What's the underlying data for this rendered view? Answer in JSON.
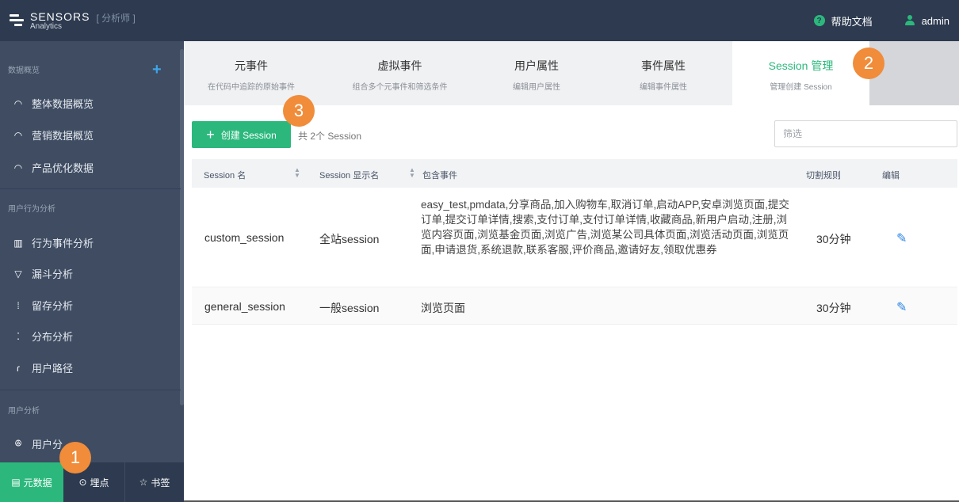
{
  "topbar": {
    "logo_name": "SENSORS",
    "logo_sub": "Analytics",
    "role": "[ 分析师 ]",
    "help": "帮助文档",
    "user": "admin"
  },
  "sidebar": {
    "sections": [
      {
        "title": "数据概览",
        "items": [
          "整体数据概览",
          "营销数据概览",
          "产品优化数据"
        ]
      },
      {
        "title": "用户行为分析",
        "items": [
          "行为事件分析",
          "漏斗分析",
          "留存分析",
          "分布分析",
          "用户路径"
        ]
      },
      {
        "title": "用户分析",
        "items": [
          "用户分"
        ]
      }
    ],
    "bottom": {
      "meta": "元数据",
      "track": "埋点",
      "bookmark": "书签"
    }
  },
  "tabs": [
    {
      "title": "元事件",
      "sub": "在代码中追踪的原始事件"
    },
    {
      "title": "虚拟事件",
      "sub": "组合多个元事件和筛选条件"
    },
    {
      "title": "用户属性",
      "sub": "编辑用户属性"
    },
    {
      "title": "事件属性",
      "sub": "编辑事件属性"
    },
    {
      "title": "Session 管理",
      "sub": "管理创建 Session"
    }
  ],
  "toolbar": {
    "create_label": "创建 Session",
    "count": "共 2个 Session",
    "filter_placeholder": "筛选"
  },
  "table": {
    "headers": [
      "Session 名",
      "Session 显示名",
      "包含事件",
      "切割规则",
      "编辑"
    ],
    "rows": [
      {
        "name": "custom_session",
        "display": "全站session",
        "events": "easy_test,pmdata,分享商品,加入购物车,取消订单,启动APP,安卓浏览页面,提交订单,提交订单详情,搜索,支付订单,支付订单详情,收藏商品,新用户启动,注册,浏览内容页面,浏览基金页面,浏览广告,浏览某公司具体页面,浏览活动页面,浏览页面,申请退货,系统退款,联系客服,评价商品,邀请好友,领取优惠券",
        "rule": "30分钟"
      },
      {
        "name": "general_session",
        "display": "一般session",
        "events": "浏览页面",
        "rule": "30分钟"
      }
    ]
  },
  "badges": [
    "1",
    "2",
    "3"
  ],
  "colors": {
    "accent": "#2cb87d",
    "badge": "#f08c3a",
    "topbar": "#2d3a4f",
    "sidebar": "#3f4c62",
    "edit": "#2b85e4"
  }
}
